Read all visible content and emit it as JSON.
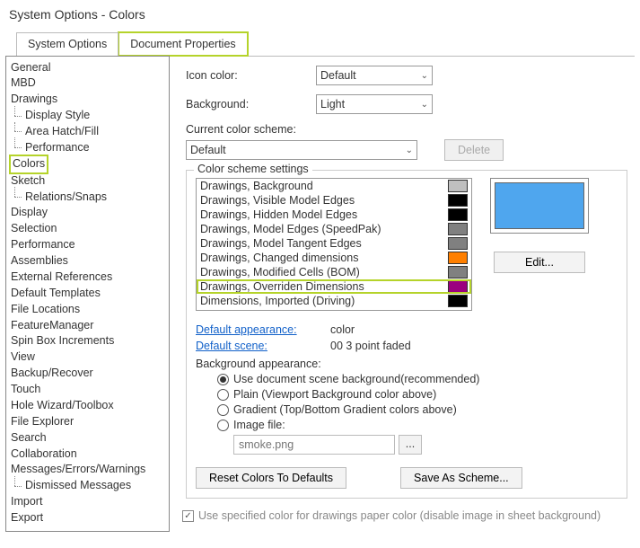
{
  "window_title": "System Options - Colors",
  "tabs": {
    "system_options": "System Options",
    "document_properties": "Document Properties"
  },
  "tree": [
    {
      "label": "General",
      "child": false
    },
    {
      "label": "MBD",
      "child": false
    },
    {
      "label": "Drawings",
      "child": false
    },
    {
      "label": "Display Style",
      "child": true
    },
    {
      "label": "Area Hatch/Fill",
      "child": true
    },
    {
      "label": "Performance",
      "child": true
    },
    {
      "label": "Colors",
      "child": false,
      "hl": true
    },
    {
      "label": "Sketch",
      "child": false
    },
    {
      "label": "Relations/Snaps",
      "child": true
    },
    {
      "label": "Display",
      "child": false
    },
    {
      "label": "Selection",
      "child": false
    },
    {
      "label": "Performance",
      "child": false
    },
    {
      "label": "Assemblies",
      "child": false
    },
    {
      "label": "External References",
      "child": false
    },
    {
      "label": "Default Templates",
      "child": false
    },
    {
      "label": "File Locations",
      "child": false
    },
    {
      "label": "FeatureManager",
      "child": false
    },
    {
      "label": "Spin Box Increments",
      "child": false
    },
    {
      "label": "View",
      "child": false
    },
    {
      "label": "Backup/Recover",
      "child": false
    },
    {
      "label": "Touch",
      "child": false
    },
    {
      "label": "Hole Wizard/Toolbox",
      "child": false
    },
    {
      "label": "File Explorer",
      "child": false
    },
    {
      "label": "Search",
      "child": false
    },
    {
      "label": "Collaboration",
      "child": false
    },
    {
      "label": "Messages/Errors/Warnings",
      "child": false
    },
    {
      "label": "Dismissed Messages",
      "child": true
    },
    {
      "label": "Import",
      "child": false
    },
    {
      "label": "Export",
      "child": false
    }
  ],
  "labels": {
    "icon_color": "Icon color:",
    "background": "Background:",
    "current_scheme": "Current color scheme:",
    "delete": "Delete",
    "scheme_settings": "Color scheme settings",
    "edit": "Edit...",
    "default_appearance": "Default appearance:",
    "default_appearance_val": "color",
    "default_scene": "Default scene:",
    "default_scene_val": "00 3 point faded",
    "bg_appearance": "Background appearance:",
    "r1": "Use document scene background(recommended)",
    "r2": "Plain (Viewport Background color above)",
    "r3": "Gradient (Top/Bottom Gradient colors above)",
    "r4": "Image file:",
    "image_placeholder": "smoke.png",
    "reset": "Reset Colors To Defaults",
    "save_as": "Save As Scheme...",
    "spec_color": "Use specified color for drawings paper color (disable image in sheet background)"
  },
  "combos": {
    "icon_color": "Default",
    "background": "Light",
    "scheme": "Default"
  },
  "scheme_items": [
    {
      "label": "Drawings, Background",
      "color": "#bfbfbf"
    },
    {
      "label": "Drawings, Visible Model Edges",
      "color": "#000000"
    },
    {
      "label": "Drawings, Hidden Model Edges",
      "color": "#000000"
    },
    {
      "label": "Drawings, Model Edges (SpeedPak)",
      "color": "#808080"
    },
    {
      "label": "Drawings, Model Tangent Edges",
      "color": "#808080"
    },
    {
      "label": "Drawings, Changed dimensions",
      "color": "#ff7f00"
    },
    {
      "label": "Drawings, Modified Cells (BOM)",
      "color": "#808080"
    },
    {
      "label": "Drawings, Overriden Dimensions",
      "color": "#9b007f",
      "hl": true
    },
    {
      "label": "Dimensions, Imported (Driving)",
      "color": "#000000"
    }
  ]
}
